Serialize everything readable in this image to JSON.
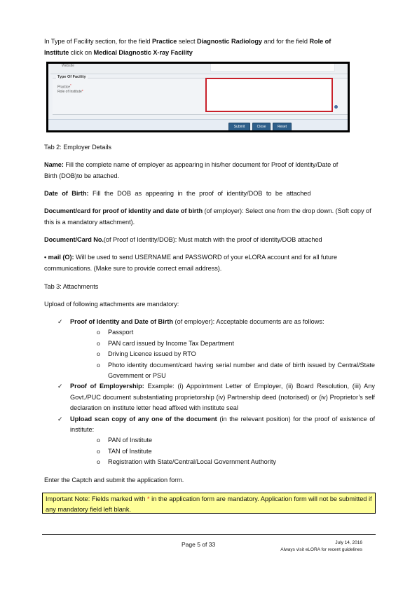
{
  "intro": {
    "line1": "In Type of Facility section, for the field ",
    "practice_bold": "Practice",
    "mid1": " select ",
    "diag_bold": "Diagnostic Radiology",
    "mid2": " and for the field ",
    "role_bold": "Role of",
    "role_bold2": "Institute",
    "mid3": " click on ",
    "medical_bold": "Medical Diagnostic X-ray Facility"
  },
  "screenshot": {
    "website_label": "Website",
    "section_title": "Type Of Facility",
    "practice_label": "Practice",
    "role_label": "Role of Institute",
    "required_mark": "*",
    "buttons": {
      "submit": "Submit",
      "close": "Close",
      "reset": "Reset"
    },
    "highlight_color": "#c8202a",
    "button_color": "#2e5f8a"
  },
  "tab2": {
    "heading": "Tab 2:  Employer Details",
    "name_label": "Name:",
    "name_text": " Fill the complete name of employer as appearing in his/her document for Proof of Identity/Date of Birth (DOB)to be attached.",
    "dob_label": "Date of Birth:",
    "dob_text": " Fill the DOB as appearing in the proof of identity/DOB to be attached",
    "doc_label": "Document/card for proof of identity and date of birth",
    "doc_text": " (of employer): Select one from the drop down. (Soft copy of this is a mandatory attachment).",
    "docno_label": "Document/Card No.",
    "docno_text": "(of Proof of Identity/DOB):  Must match with the proof of identity/DOB attached",
    "email_label": "• mail (O):",
    "email_text": "  Will be used to send USERNAME and PASSWORD of your eLORA account and for all future communications. (Make sure to provide correct email address)."
  },
  "tab3": {
    "heading": "Tab 3:  Attachments",
    "intro": "Upload of following attachments are mandatory:",
    "items": [
      {
        "bold": "Proof of Identity and Date of Birth",
        "text": " (of employer): Acceptable documents are as follows:",
        "subitems": [
          "Passport",
          "PAN card issued by Income Tax Department",
          "Driving Licence issued by RTO",
          "Photo identity document/card having serial number and date of birth issued by Central/State Government or PSU"
        ]
      },
      {
        "bold": "Proof of Employership:",
        "text": " Example: (i) Appointment Letter of Employer, (ii) Board Resolution, (iii) Any Govt./PUC document substantiating proprietorship (iv) Partnership deed (notorised) or (iv) Proprietor’s self declaration on institute letter head affixed with institute seal",
        "subitems": []
      },
      {
        "bold": "Upload scan copy of any one of the document",
        "text": " (in the relevant position) for the proof of existence of institute:",
        "subitems": [
          "PAN of Institute",
          "TAN of Institute",
          "Registration with State/Central/Local Government Authority"
        ]
      }
    ],
    "checkmark": "✓",
    "bullet": "o"
  },
  "captcha_text": "Enter the Captch and submit the application form.",
  "note": {
    "label": "Important Note:",
    "before_star": " Fields marked with ",
    "star": "*",
    "after_star": " in the application form are mandatory. Application form will not be submitted if any mandatory field left blank.",
    "background": "#ffff99"
  },
  "footer": {
    "page": "Page 5 of 33",
    "date": "July 14, 2016",
    "note": "Always visit eLORA for recent guidelines"
  }
}
